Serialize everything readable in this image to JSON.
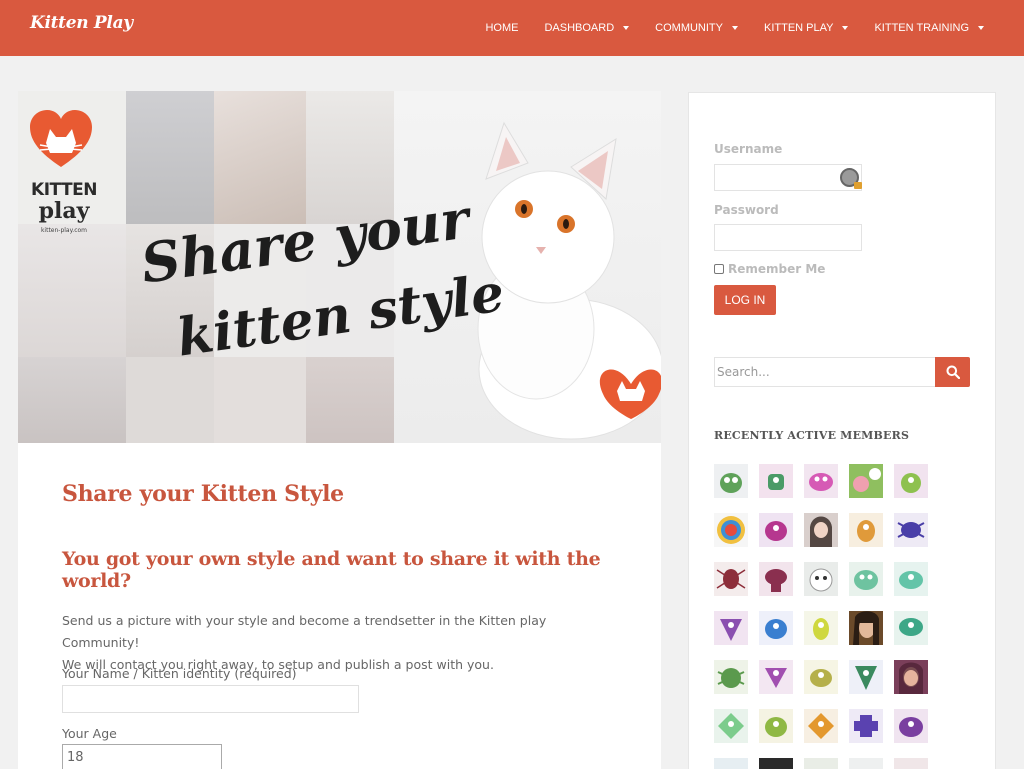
{
  "header": {
    "logo": "Kitten Play",
    "nav": [
      {
        "label": "HOME",
        "dropdown": false
      },
      {
        "label": "DASHBOARD",
        "dropdown": true
      },
      {
        "label": "COMMUNITY",
        "dropdown": true
      },
      {
        "label": "KITTEN PLAY",
        "dropdown": true
      },
      {
        "label": "KITTEN TRAINING",
        "dropdown": true
      }
    ]
  },
  "banner": {
    "logo_kitten": "KITTEN",
    "logo_play": "play",
    "logo_url": "kitten-play.com",
    "tagline_1": "Share your",
    "tagline_2": "kitten style"
  },
  "content": {
    "page_title": "Share your Kitten Style",
    "sub_title": "You got your own style and want to share it with the world?",
    "intro_line_1": "Send us a picture with your style and become a trendsetter in the Kitten play Community!",
    "intro_line_2": "We will contact you right away, to setup and publish a post with you.",
    "name_label": "Your Name / Kitten identity (required)",
    "name_value": "",
    "age_label": "Your Age",
    "age_value": "18"
  },
  "sidebar": {
    "username_label": "Username",
    "password_label": "Password",
    "remember_label": "Remember Me",
    "login_label": "LOG IN",
    "search_placeholder": "Search...",
    "recent_title": "RECENTLY ACTIVE MEMBERS"
  },
  "colors": {
    "accent": "#d9593f",
    "heading": "#c8563e",
    "page_bg": "#f1f1f1"
  },
  "icons": {
    "search": "search-icon",
    "password_manager": "key-lock-icon",
    "dropdown": "chevron-down-icon"
  }
}
